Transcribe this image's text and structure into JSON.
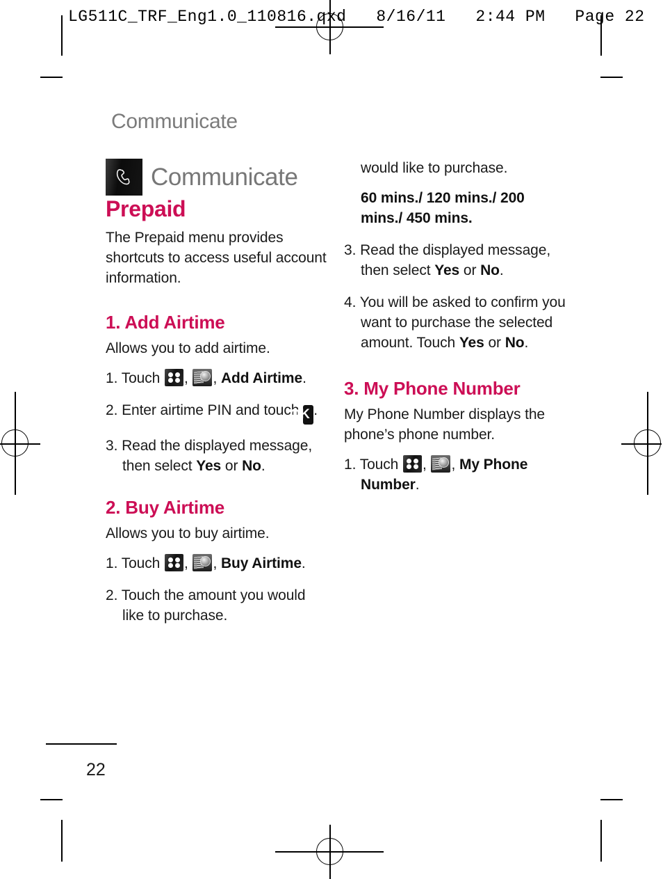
{
  "print_header": "LG511C_TRF_Eng1.0_110816.qxd   8/16/11   2:44 PM   Page 22",
  "running_head": "Communicate",
  "chapter": {
    "icon": "phone-handset-icon",
    "title": "Communicate"
  },
  "section": {
    "title": "Prepaid",
    "intro": "The Prepaid menu provides shortcuts to access useful account information."
  },
  "icons": {
    "menu": "menu-grid-icon",
    "coins": "coins-icon",
    "ok": "OK"
  },
  "subsections": [
    {
      "heading": "1. Add Airtime",
      "intro": "Allows you to add airtime.",
      "steps": [
        {
          "num": "1.",
          "pre": "Touch ",
          "mid": ", ",
          "bold": "Add Airtime",
          "post": "."
        },
        {
          "num": "2.",
          "pre": "Enter airtime PIN and touch ",
          "post": "."
        },
        {
          "num": "3.",
          "pre": "Read the displayed message, then select ",
          "bold": "Yes",
          "mid": " or ",
          "bold2": "No",
          "post": "."
        }
      ]
    },
    {
      "heading": "2. Buy Airtime",
      "intro": "Allows you to buy airtime.",
      "steps": [
        {
          "num": "1.",
          "pre": "Touch ",
          "mid": ", ",
          "bold": "Buy Airtime",
          "post": "."
        },
        {
          "num": "2.",
          "pre": "Touch the amount you would like to purchase."
        }
      ]
    },
    {
      "heading": "3. My Phone Number",
      "intro": "My Phone Number displays the phone’s phone number.",
      "steps": [
        {
          "num": "1.",
          "pre": "Touch ",
          "mid": ", ",
          "bold": "My Phone Number",
          "post": "."
        }
      ]
    }
  ],
  "right_column": {
    "cont_step2": "would like to purchase.",
    "amount_options": "60 mins./ 120 mins./ 200 mins./ 450 mins.",
    "step3": {
      "num": "3.",
      "pre": "Read the displayed message, then select ",
      "bold": "Yes",
      "mid": " or ",
      "bold2": "No",
      "post": "."
    },
    "step4": {
      "num": "4.",
      "pre": "You will be asked to confirm you want to purchase the selected amount. Touch ",
      "bold": "Yes",
      "mid": " or ",
      "bold2": "No",
      "post": "."
    }
  },
  "footer": {
    "page_number": "22"
  },
  "colors": {
    "accent": "#cc0e55",
    "running_head": "#7b7b7b",
    "body": "#1a1a1a"
  }
}
